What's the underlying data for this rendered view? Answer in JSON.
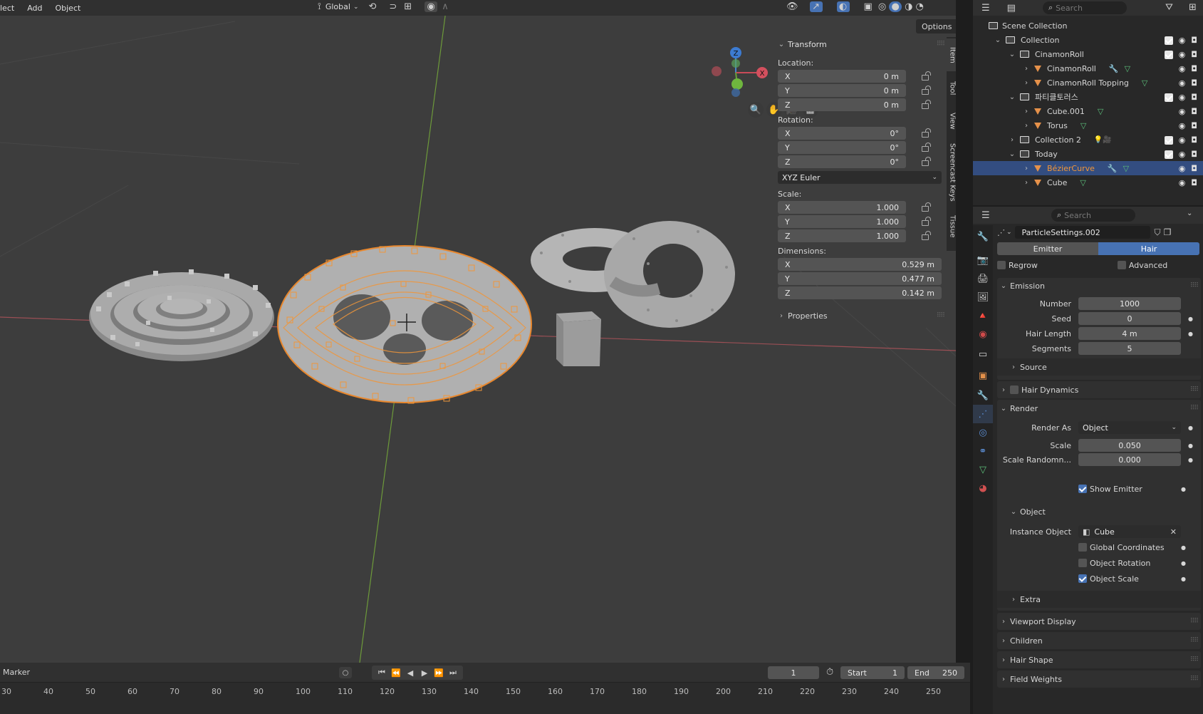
{
  "menu": {
    "items": [
      "lect",
      "Add",
      "Object"
    ]
  },
  "header": {
    "orientation": "Global",
    "options_label": "Options"
  },
  "sidebar_tabs": [
    "Item",
    "Tool",
    "View",
    "Screencast Keys",
    "Tissue"
  ],
  "transform": {
    "title": "Transform",
    "location_label": "Location:",
    "location": [
      {
        "axis": "X",
        "value": "0 m"
      },
      {
        "axis": "Y",
        "value": "0 m"
      },
      {
        "axis": "Z",
        "value": "0 m"
      }
    ],
    "rotation_label": "Rotation:",
    "rotation": [
      {
        "axis": "X",
        "value": "0°"
      },
      {
        "axis": "Y",
        "value": "0°"
      },
      {
        "axis": "Z",
        "value": "0°"
      }
    ],
    "rotation_mode": "XYZ Euler",
    "scale_label": "Scale:",
    "scale": [
      {
        "axis": "X",
        "value": "1.000"
      },
      {
        "axis": "Y",
        "value": "1.000"
      },
      {
        "axis": "Z",
        "value": "1.000"
      }
    ],
    "dimensions_label": "Dimensions:",
    "dimensions": [
      {
        "axis": "X",
        "value": "0.529 m"
      },
      {
        "axis": "Y",
        "value": "0.477 m"
      },
      {
        "axis": "Z",
        "value": "0.142 m"
      }
    ],
    "properties_label": "Properties"
  },
  "outliner": {
    "search_placeholder": "Search",
    "scene_collection": "Scene Collection",
    "items": [
      {
        "label": "Collection",
        "type": "collection",
        "depth": 0
      },
      {
        "label": "CinamonRoll",
        "type": "collection",
        "depth": 1
      },
      {
        "label": "CinamonRoll",
        "type": "mesh",
        "depth": 2
      },
      {
        "label": "CinamonRoll Topping",
        "type": "mesh",
        "depth": 2
      },
      {
        "label": "파티클토러스",
        "type": "collection",
        "depth": 1
      },
      {
        "label": "Cube.001",
        "type": "mesh",
        "depth": 2
      },
      {
        "label": "Torus",
        "type": "mesh",
        "depth": 2
      },
      {
        "label": "Collection 2",
        "type": "collection",
        "depth": 1
      },
      {
        "label": "Today",
        "type": "collection",
        "depth": 1
      },
      {
        "label": "BézierCurve",
        "type": "mesh",
        "depth": 2,
        "selected": true
      },
      {
        "label": "Cube",
        "type": "mesh",
        "depth": 2
      }
    ]
  },
  "properties": {
    "search_placeholder": "Search",
    "settings_name": "ParticleSettings.002",
    "type_tabs": [
      "Emitter",
      "Hair"
    ],
    "active_type": "Hair",
    "regrow": "Regrow",
    "advanced": "Advanced",
    "emission": {
      "title": "Emission",
      "fields": [
        {
          "label": "Number",
          "value": "1000"
        },
        {
          "label": "Seed",
          "value": "0"
        },
        {
          "label": "Hair Length",
          "value": "4 m"
        },
        {
          "label": "Segments",
          "value": "5"
        }
      ],
      "source": "Source"
    },
    "hair_dynamics": "Hair Dynamics",
    "render": {
      "title": "Render",
      "render_as_label": "Render As",
      "render_as_value": "Object",
      "scale_label": "Scale",
      "scale_value": "0.050",
      "scale_random_label": "Scale Randomn...",
      "scale_random_value": "0.000",
      "show_emitter": "Show Emitter",
      "object_title": "Object",
      "instance_object_label": "Instance Object",
      "instance_object_value": "Cube",
      "global_coordinates": "Global Coordinates",
      "object_rotation": "Object Rotation",
      "object_scale": "Object Scale",
      "extra": "Extra"
    },
    "sections": [
      "Viewport Display",
      "Children",
      "Hair Shape",
      "Field Weights"
    ]
  },
  "timeline": {
    "marker": "Marker",
    "current_frame": "1",
    "start_label": "Start",
    "start_value": "1",
    "end_label": "End",
    "end_value": "250",
    "ruler": [
      "30",
      "40",
      "50",
      "60",
      "70",
      "80",
      "90",
      "100",
      "110",
      "120",
      "130",
      "140",
      "150",
      "160",
      "170",
      "180",
      "190",
      "200",
      "210",
      "220",
      "230",
      "240",
      "250"
    ]
  },
  "colors": {
    "accent": "#4772b3",
    "selection": "#f0963a",
    "mesh_icon": "#e5914a",
    "green_icon": "#5cbf7a"
  }
}
